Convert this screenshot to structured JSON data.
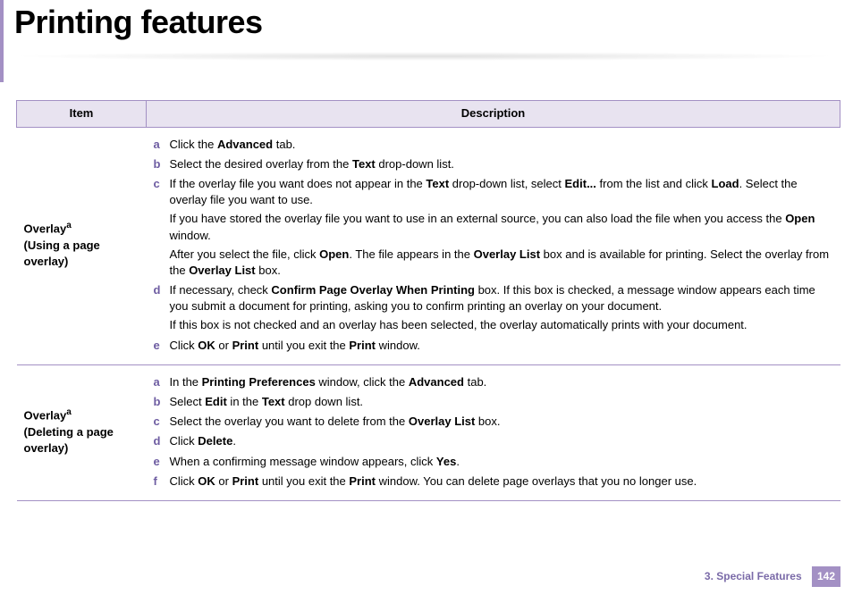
{
  "page_title": "Printing features",
  "table": {
    "headers": {
      "item": "Item",
      "description": "Description"
    },
    "rows": [
      {
        "item_name": "Overlay",
        "item_sup": "a",
        "item_sub": "(Using a page overlay)",
        "steps": [
          {
            "m": "a",
            "segments": [
              "Click the ",
              "Advanced",
              " tab."
            ]
          },
          {
            "m": "b",
            "segments": [
              "Select the desired overlay from the ",
              "Text",
              " drop-down list."
            ]
          },
          {
            "m": "c",
            "segments": [
              "If the overlay file you want does not appear in the ",
              "Text",
              " drop-down list, select ",
              "Edit...",
              " from the list and click ",
              "Load",
              ". Select the overlay file you want to use."
            ],
            "subs": [
              [
                "If you have stored the overlay file you want to use in an external source, you can also load the file when you access the ",
                "Open",
                " window."
              ],
              [
                "After you select the file, click ",
                "Open",
                ". The file appears in the ",
                "Overlay List",
                " box and is available for printing. Select the overlay from the ",
                "Overlay List",
                " box."
              ]
            ]
          },
          {
            "m": "d",
            "segments": [
              "If necessary, check ",
              "Confirm Page Overlay When Printing",
              " box. If this box is checked, a message window appears each time you submit a document for printing, asking you to confirm printing an overlay on your document."
            ],
            "subs": [
              [
                "If this box is not checked and an overlay has been selected, the overlay automatically prints with your document."
              ]
            ]
          },
          {
            "m": "e",
            "segments": [
              "Click ",
              "OK",
              " or ",
              "Print",
              " until you exit the ",
              "Print",
              " window."
            ]
          }
        ]
      },
      {
        "item_name": "Overlay",
        "item_sup": "a",
        "item_sub": "(Deleting a page overlay)",
        "steps": [
          {
            "m": "a",
            "segments": [
              "In the ",
              "Printing Preferences",
              " window, click the ",
              "Advanced",
              " tab."
            ]
          },
          {
            "m": "b",
            "segments": [
              "Select ",
              "Edit",
              " in the ",
              "Text",
              " drop down list."
            ]
          },
          {
            "m": "c",
            "segments": [
              "Select the overlay you want to delete from the ",
              "Overlay List",
              " box."
            ]
          },
          {
            "m": "d",
            "segments": [
              "Click ",
              "Delete",
              "."
            ]
          },
          {
            "m": "e",
            "segments": [
              "When a confirming message window appears, click ",
              "Yes",
              "."
            ]
          },
          {
            "m": "f",
            "segments": [
              "Click ",
              "OK",
              " or ",
              "Print",
              " until you exit the ",
              "Print",
              " window. You can delete page overlays that you no longer use."
            ]
          }
        ]
      }
    ]
  },
  "footer": {
    "chapter": "3.  Special Features",
    "page": "142"
  }
}
